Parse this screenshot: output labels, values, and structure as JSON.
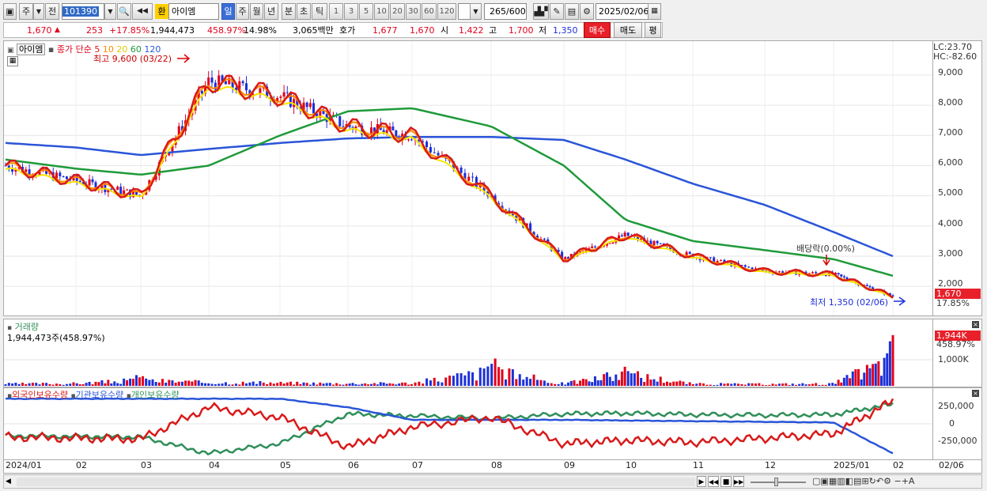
{
  "toolbar": {
    "market_tab": "주",
    "prev_tab": "전",
    "code": "101390",
    "market_badge": "환",
    "name": "아이엠",
    "period_day": "일",
    "period_week": "주",
    "period_month": "월",
    "period_year": "년",
    "period_min": "분",
    "period_sec": "초",
    "period_tick": "틱",
    "intervals": [
      "1",
      "3",
      "5",
      "10",
      "20",
      "30",
      "60",
      "120"
    ],
    "count": "265",
    "count_total": "/600",
    "date": "2025/02/06"
  },
  "quote": {
    "price": "1,670",
    "change_arrow": "▲",
    "change": "253",
    "change_pct": "+17.85%",
    "volume": "1,944,473",
    "vol_ratio": "458.97%",
    "turnover_rate": "14.98%",
    "amount": "3,065백만",
    "bid_label": "호가",
    "bid1": "1,677",
    "bid2": "1,670",
    "open_label": "시",
    "open": "1,422",
    "high_label": "고",
    "high": "1,700",
    "low_label": "저",
    "low": "1,350",
    "buy_btn": "매수",
    "sell_btn": "매도",
    "eval_btn": "평"
  },
  "price_pane": {
    "stock_label": "아이엠",
    "legend_prefix": "종가 단순",
    "ma_labels": [
      "5",
      "10",
      "20",
      "60",
      "120"
    ],
    "high_note": "최고 9,600 (03/22)",
    "low_note": "최저 1,350 (02/06)",
    "div_note": "배당락(0.00%)",
    "lc": "LC:23.70",
    "hc": "HC:-82.60",
    "yticks": [
      "9,000",
      "8,000",
      "7,000",
      "6,000",
      "5,000",
      "4,000",
      "3,000",
      "2,000"
    ],
    "cur_price": "1,670",
    "cur_pct": "17.85%"
  },
  "volume_pane": {
    "title": "거래량",
    "detail": "1,944,473주(458.97%)",
    "ytick": "1,000K",
    "cur_vol": "1,944K",
    "cur_pct": "458.97%"
  },
  "holder_pane": {
    "legend": [
      "외국인보유수량",
      "기관보유수량",
      "개인보유수량"
    ],
    "yticks": [
      "250,000",
      "0",
      "-250,000"
    ]
  },
  "xaxis": {
    "labels": [
      "2024/01",
      "02",
      "03",
      "04",
      "05",
      "06",
      "07",
      "08",
      "09",
      "10",
      "11",
      "12",
      "2025/01",
      "02"
    ],
    "end_label": "02/06"
  },
  "colors": {
    "up": "#e0001a",
    "down": "#1c2fd8",
    "ma5": "#d81a1a",
    "ma10": "#ff8a00",
    "ma20": "#f7e600",
    "ma60": "#1f9a3a",
    "ma120": "#2a55d8",
    "foreign": "#d81a1a",
    "inst": "#2a55d8",
    "indiv": "#2f8f5a"
  },
  "chart_data": [
    {
      "type": "line",
      "title": "",
      "x": [
        "2024/01",
        "02",
        "03",
        "04",
        "05",
        "06",
        "07",
        "08",
        "09",
        "10",
        "11",
        "12",
        "2025/01",
        "02"
      ],
      "ylim": [
        1350,
        9600
      ],
      "series": [
        {
          "name": "종가",
          "values": [
            6000,
            5500,
            5000,
            8800,
            8300,
            7300,
            7000,
            5000,
            2900,
            3700,
            3000,
            2500,
            2400,
            1670
          ]
        },
        {
          "name": "120",
          "values": [
            6750,
            6600,
            6350,
            6550,
            6750,
            6900,
            6950,
            6950,
            6850,
            6200,
            5400,
            4700,
            3800,
            3000
          ]
        },
        {
          "name": "60",
          "values": [
            6200,
            5900,
            5700,
            6000,
            7000,
            7800,
            7900,
            7300,
            6000,
            4200,
            3500,
            3200,
            2900,
            2350
          ]
        }
      ]
    },
    {
      "type": "bar",
      "title": "거래량",
      "x": [
        "2024/01",
        "02",
        "03",
        "04",
        "05",
        "06",
        "07",
        "08",
        "09",
        "10",
        "11",
        "12",
        "2025/01",
        "02"
      ],
      "values": [
        150,
        180,
        420,
        250,
        220,
        180,
        200,
        1100,
        160,
        900,
        150,
        130,
        160,
        1944
      ]
    },
    {
      "type": "line",
      "title": "",
      "x": [
        "2024/01",
        "02",
        "03",
        "04",
        "05",
        "06",
        "07",
        "08",
        "09",
        "10",
        "11",
        "12",
        "2025/01",
        "02"
      ],
      "ylim": [
        -300000,
        300000
      ],
      "series": [
        {
          "name": "외국인보유수량",
          "values": [
            -200000,
            -220000,
            -230000,
            250000,
            100000,
            -350000,
            -50000,
            100000,
            -300000,
            -250000,
            -280000,
            -220000,
            -150000,
            350000
          ]
        },
        {
          "name": "기관보유수량",
          "values": [
            380000,
            380000,
            380000,
            380000,
            380000,
            250000,
            60000,
            60000,
            60000,
            50000,
            40000,
            30000,
            20000,
            -450000
          ]
        },
        {
          "name": "개인보유수량",
          "values": [
            -180000,
            -190000,
            -200000,
            -450000,
            -300000,
            150000,
            120000,
            80000,
            150000,
            160000,
            140000,
            130000,
            140000,
            300000
          ]
        }
      ]
    }
  ]
}
